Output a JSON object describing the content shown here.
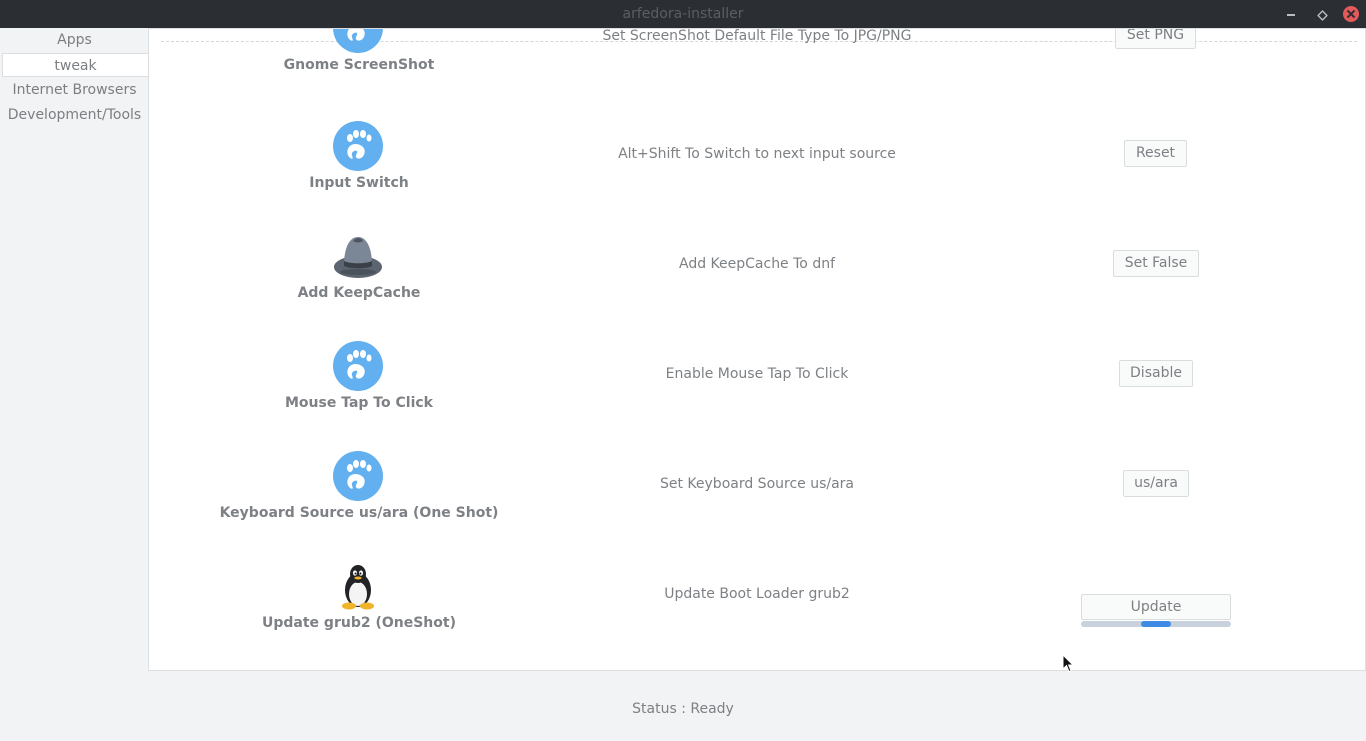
{
  "window": {
    "title": "arfedora-installer"
  },
  "sidebar": {
    "items": [
      {
        "label": "Apps",
        "active": false
      },
      {
        "label": "tweak",
        "active": true
      },
      {
        "label": "Internet Browsers",
        "active": false
      },
      {
        "label": "Development/Tools",
        "active": false
      }
    ]
  },
  "tweaks": [
    {
      "name": "Gnome ScreenShot",
      "icon": "gnome-foot-icon",
      "description": "Set ScreenShot Default File Type To JPG/PNG",
      "button": "Set PNG"
    },
    {
      "name": "Input Switch",
      "icon": "gnome-foot-icon",
      "description": "Alt+Shift To Switch to next input source",
      "button": "Reset"
    },
    {
      "name": "Add KeepCache",
      "icon": "fedora-hat-icon",
      "description": "Add KeepCache To dnf",
      "button": "Set False"
    },
    {
      "name": "Mouse Tap To Click",
      "icon": "gnome-foot-icon",
      "description": "Enable Mouse Tap To Click",
      "button": "Disable"
    },
    {
      "name": "Keyboard Source us/ara (One Shot)",
      "icon": "gnome-foot-icon",
      "description": "Set Keyboard Source us/ara",
      "button": "us/ara"
    },
    {
      "name": "Update grub2 (OneShot)",
      "icon": "tux-penguin-icon",
      "description": "Update Boot Loader grub2",
      "button": "Update"
    }
  ],
  "progress": {
    "fraction": 0.2,
    "activity_mode": true
  },
  "status": {
    "text": "Status : Ready"
  },
  "colors": {
    "accent": "#3f8ae2",
    "gnome_icon": "#62b0ef",
    "titlebar": "#2b2e33",
    "close": "#e45a5a"
  }
}
